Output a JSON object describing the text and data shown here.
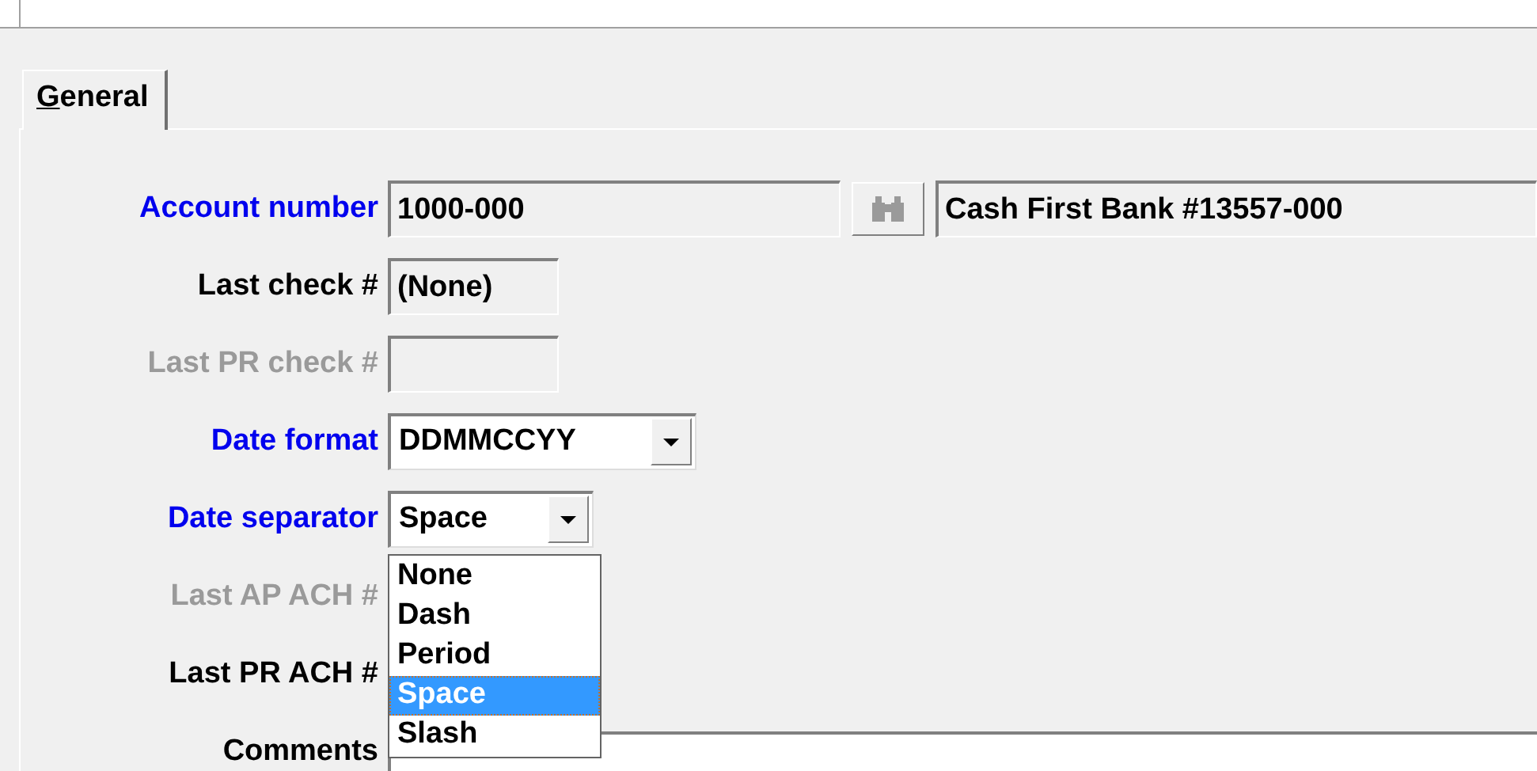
{
  "tabs": [
    {
      "label": "General",
      "selected": true
    }
  ],
  "fields": [
    {
      "label": "Account number",
      "required": true,
      "disabled": false,
      "kind": "lookup",
      "value": "1000-000",
      "description": "Cash First Bank #13557-000"
    },
    {
      "label": "Last check #",
      "required": false,
      "disabled": false,
      "kind": "readonly",
      "value": "(None)"
    },
    {
      "label": "Last PR check #",
      "disabled": true,
      "kind": "readonly"
    },
    {
      "label": "Date format",
      "required": true,
      "disabled": false,
      "kind": "combo",
      "value": "DDMMCCYY"
    },
    {
      "label": "Date separator",
      "required": true,
      "disabled": false,
      "kind": "combo",
      "value": "Space",
      "expanded": true,
      "options": [
        {
          "label": "None",
          "selected": false
        },
        {
          "label": "Dash",
          "selected": false
        },
        {
          "label": "Period",
          "selected": false
        },
        {
          "label": "Space",
          "selected": true
        },
        {
          "label": "Slash",
          "selected": false
        }
      ]
    },
    {
      "label": "Last AP ACH #",
      "disabled": true,
      "kind": "covered"
    },
    {
      "label": "Last PR ACH #",
      "required": false,
      "disabled": false,
      "kind": "covered"
    },
    {
      "label": "Comments",
      "required": false,
      "disabled": false,
      "kind": "memo"
    }
  ]
}
